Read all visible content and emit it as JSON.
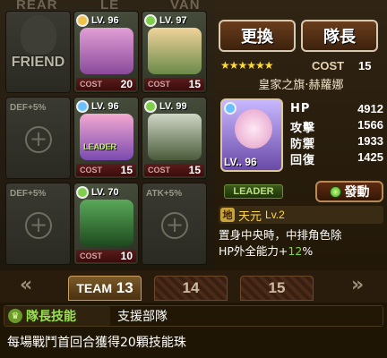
{
  "board": {
    "header_left": "REAR",
    "header_mid": "LE",
    "header_right": "VAN",
    "slots": [
      {
        "kind": "friend",
        "label": "FRIEND"
      },
      {
        "kind": "card",
        "lv": "LV. 96",
        "cost_label": "COST",
        "cost": "20",
        "attr_color": "#f0c24a",
        "face": "#c06bb0"
      },
      {
        "kind": "card",
        "lv": "LV. 97",
        "cost_label": "COST",
        "cost": "15",
        "attr_color": "#7fcf4a",
        "face": "#d9b36a"
      },
      {
        "kind": "empty",
        "bonus": "DEF+5%"
      },
      {
        "kind": "card",
        "lv": "LV. 96",
        "cost_label": "COST",
        "cost": "15",
        "attr_color": "#6abfff",
        "face": "#e07bb6",
        "tag": "LEADER"
      },
      {
        "kind": "card",
        "lv": "LV. 99",
        "cost_label": "COST",
        "cost": "15",
        "attr_color": "#7fcf4a",
        "face": "#6a8a5a"
      },
      {
        "kind": "empty",
        "bonus": "DEF+5%"
      },
      {
        "kind": "card",
        "lv": "LV. 70",
        "cost_label": "COST",
        "cost": "10",
        "attr_color": "#7fcf4a",
        "face": "#3e7a3a"
      },
      {
        "kind": "empty",
        "bonus": "ATK+5%"
      }
    ]
  },
  "panel": {
    "swap_button": "更換",
    "leader_button": "隊長",
    "stars": "★★★★★★",
    "cost_label": "COST",
    "cost_value": "15",
    "card_name": "皇家之旗·赫蘿娜",
    "portrait_lv": "LV.. 96",
    "stats": [
      {
        "key": "HP",
        "value": "4912"
      },
      {
        "key": "攻擊",
        "value": "1566"
      },
      {
        "key": "防禦",
        "value": "1933"
      },
      {
        "key": "回復",
        "value": "1425"
      }
    ],
    "leader_badge": "LEADER",
    "activate_button": "發動",
    "element_icon": "地",
    "skill_name": "天元",
    "skill_lv": "Lv.2",
    "skill_desc_1": "置身中央時，中排角色除",
    "skill_desc_2a": "HP外全能力+",
    "skill_desc_2b": "12",
    "skill_desc_2c": "%",
    "accent_green": "#7fd44a"
  },
  "tabs": {
    "items": [
      {
        "label": "TEAM",
        "num": "13",
        "active": true
      },
      {
        "label": "14",
        "active": false
      },
      {
        "label": "15",
        "active": false
      }
    ]
  },
  "bottom": {
    "leader_skill_label": "隊長技能",
    "leader_skill_name": "支援部隊",
    "leader_skill_desc": "每場戰鬥首回合獲得20顆技能珠"
  }
}
